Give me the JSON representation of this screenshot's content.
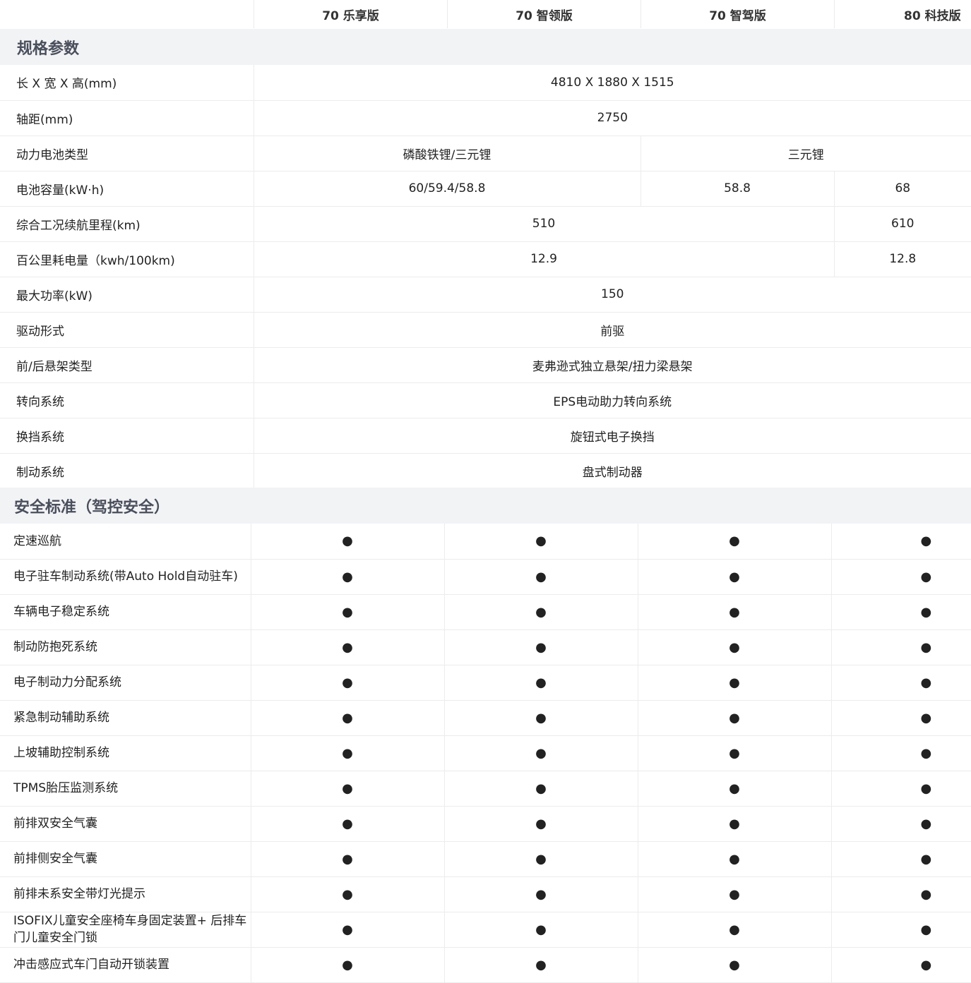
{
  "header": {
    "columns": [
      "70 乐享版",
      "70 智领版",
      "70 智驾版",
      "80 科技版"
    ]
  },
  "spec_section": {
    "title": "规格参数",
    "rows": [
      {
        "label": "长 X 宽 X 高(mm)",
        "cells": [
          {
            "text": "4810 X 1880 X 1515",
            "span": 4
          }
        ]
      },
      {
        "label": "轴距(mm)",
        "cells": [
          {
            "text": "2750",
            "span": 4
          }
        ]
      },
      {
        "label": "动力电池类型",
        "cells": [
          {
            "text": "磷酸铁锂/三元锂",
            "span": 2
          },
          {
            "text": "三元锂",
            "span": 2
          }
        ]
      },
      {
        "label": "电池容量(kW·h)",
        "cells": [
          {
            "text": "60/59.4/58.8",
            "span": 2
          },
          {
            "text": "58.8",
            "span": 1
          },
          {
            "text": "68",
            "span": 1
          }
        ]
      },
      {
        "label": "综合工况续航里程(km)",
        "cells": [
          {
            "text": "510",
            "span": 3
          },
          {
            "text": "610",
            "span": 1
          }
        ]
      },
      {
        "label": "百公里耗电量（kwh/100km)",
        "cells": [
          {
            "text": "12.9",
            "span": 3
          },
          {
            "text": "12.8",
            "span": 1
          }
        ]
      },
      {
        "label": "最大功率(kW)",
        "cells": [
          {
            "text": "150",
            "span": 4
          }
        ]
      },
      {
        "label": "驱动形式",
        "cells": [
          {
            "text": "前驱",
            "span": 4
          }
        ]
      },
      {
        "label": "前/后悬架类型",
        "cells": [
          {
            "text": "麦弗逊式独立悬架/扭力梁悬架",
            "span": 4
          }
        ]
      },
      {
        "label": "转向系统",
        "cells": [
          {
            "text": "EPS电动助力转向系统",
            "span": 4
          }
        ]
      },
      {
        "label": "换挡系统",
        "cells": [
          {
            "text": "旋钮式电子换挡",
            "span": 4
          }
        ]
      },
      {
        "label": "制动系统",
        "cells": [
          {
            "text": "盘式制动器",
            "span": 4
          }
        ]
      }
    ]
  },
  "safety_section": {
    "title": "安全标准（驾控安全）",
    "rows": [
      {
        "label": "定速巡航",
        "values": [
          "●",
          "●",
          "●",
          "●"
        ]
      },
      {
        "label": "电子驻车制动系统(带Auto Hold自动驻车)",
        "values": [
          "●",
          "●",
          "●",
          "●"
        ]
      },
      {
        "label": "车辆电子稳定系统",
        "values": [
          "●",
          "●",
          "●",
          "●"
        ]
      },
      {
        "label": "制动防抱死系统",
        "values": [
          "●",
          "●",
          "●",
          "●"
        ]
      },
      {
        "label": "电子制动力分配系统",
        "values": [
          "●",
          "●",
          "●",
          "●"
        ]
      },
      {
        "label": "紧急制动辅助系统",
        "values": [
          "●",
          "●",
          "●",
          "●"
        ]
      },
      {
        "label": "上坡辅助控制系统",
        "values": [
          "●",
          "●",
          "●",
          "●"
        ]
      },
      {
        "label": "TPMS胎压监测系统",
        "values": [
          "●",
          "●",
          "●",
          "●"
        ]
      },
      {
        "label": "前排双安全气囊",
        "values": [
          "●",
          "●",
          "●",
          "●"
        ]
      },
      {
        "label": "前排侧安全气囊",
        "values": [
          "●",
          "●",
          "●",
          "●"
        ]
      },
      {
        "label": "前排未系安全带灯光提示",
        "values": [
          "●",
          "●",
          "●",
          "●"
        ]
      },
      {
        "label": "ISOFIX儿童安全座椅车身固定装置+ 后排车门儿童安全门锁",
        "values": [
          "●",
          "●",
          "●",
          "●"
        ]
      },
      {
        "label": "冲击感应式车门自动开锁装置",
        "values": [
          "●",
          "●",
          "●",
          "●"
        ]
      }
    ]
  }
}
